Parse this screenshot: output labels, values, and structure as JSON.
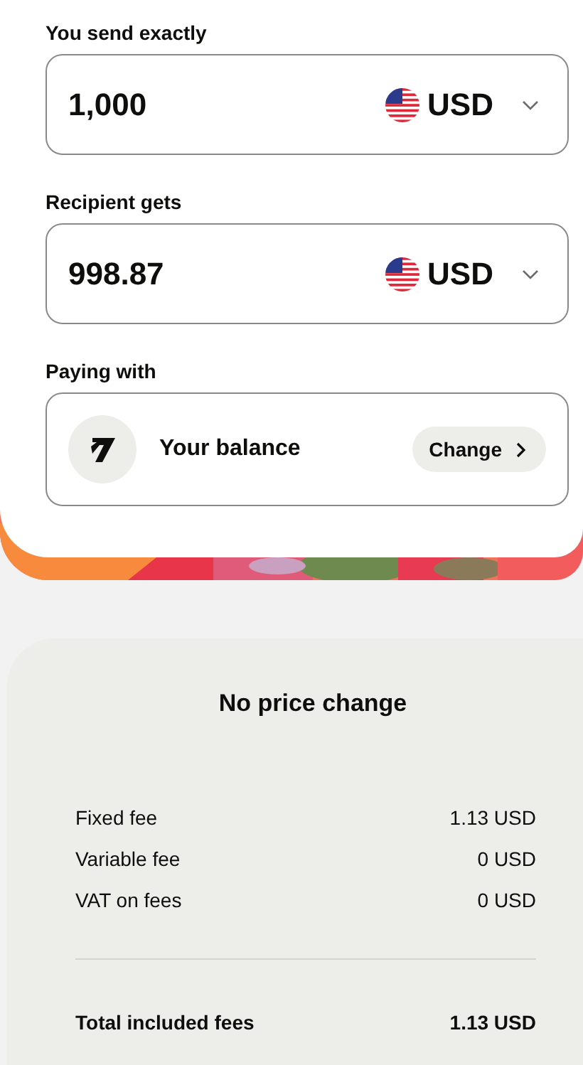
{
  "send": {
    "label": "You send exactly",
    "amount": "1,000",
    "currency": "USD"
  },
  "receive": {
    "label": "Recipient gets",
    "amount": "998.87",
    "currency": "USD"
  },
  "paying_with": {
    "label": "Paying with",
    "method": "Your balance",
    "button": "Change"
  },
  "fees": {
    "title": "No price change",
    "rows": [
      {
        "label": "Fixed fee",
        "value": "1.13 USD"
      },
      {
        "label": "Variable fee",
        "value": "0 USD"
      },
      {
        "label": "VAT on fees",
        "value": "0 USD"
      }
    ],
    "total": {
      "label": "Total included fees",
      "value": "1.13 USD"
    }
  }
}
